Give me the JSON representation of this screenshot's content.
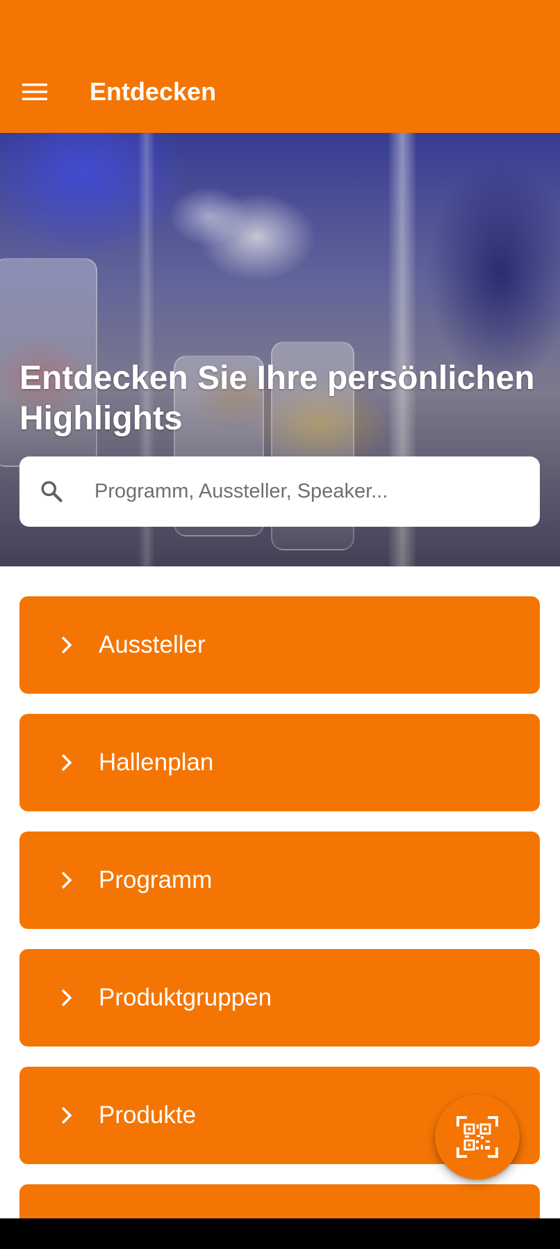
{
  "app_bar": {
    "title": "Entdecken",
    "menu_icon": "hamburger-menu-icon",
    "background": "#F47504"
  },
  "hero": {
    "heading": "Entdecken Sie Ihre persönlichen Highlights",
    "search": {
      "placeholder": "Programm, Aussteller, Speaker...",
      "value": "",
      "icon": "search-icon"
    }
  },
  "nav_items": [
    {
      "label": "Aussteller",
      "icon": "chevron-right-icon"
    },
    {
      "label": "Hallenplan",
      "icon": "chevron-right-icon"
    },
    {
      "label": "Programm",
      "icon": "chevron-right-icon"
    },
    {
      "label": "Produktgruppen",
      "icon": "chevron-right-icon"
    },
    {
      "label": "Produkte",
      "icon": "chevron-right-icon"
    },
    {
      "label": "",
      "icon": "chevron-right-icon"
    }
  ],
  "fab": {
    "icon": "qr-code-scan-icon"
  },
  "colors": {
    "accent": "#F47504",
    "text_on_accent": "#FFFFFF"
  }
}
